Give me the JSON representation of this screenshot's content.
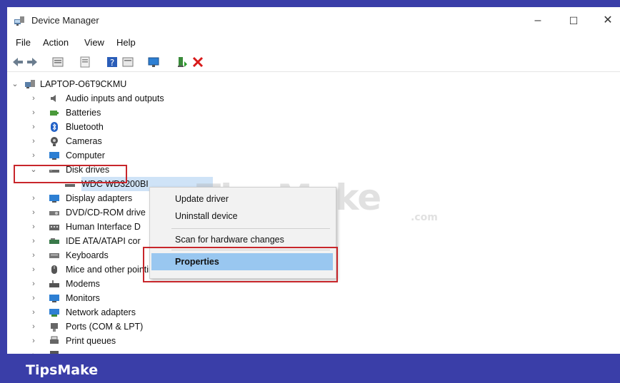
{
  "window": {
    "title": "Device Manager",
    "controls": {
      "minimize": "–",
      "maximize": "☐",
      "close": "✕"
    }
  },
  "menu": [
    "File",
    "Action",
    "View",
    "Help"
  ],
  "tree": {
    "root": "LAPTOP-O6T9CKMU",
    "categories": [
      "Audio inputs and outputs",
      "Batteries",
      "Bluetooth",
      "Cameras",
      "Computer",
      "Disk drives",
      "Display adapters",
      "DVD/CD-ROM drive",
      "Human Interface D",
      "IDE ATA/ATAPI cor",
      "Keyboards",
      "Mice and other pointing devices",
      "Modems",
      "Monitors",
      "Network adapters",
      "Ports (COM & LPT)",
      "Print queues"
    ],
    "disk_child": "WDC WD3200BI"
  },
  "context_menu": {
    "update": "Update driver",
    "uninstall": "Uninstall device",
    "scan": "Scan for hardware changes",
    "properties": "Properties"
  },
  "colors": {
    "highlight_box": "#c8262b",
    "selected_bg": "#99c7f0",
    "brand_bar": "#3a3ea8"
  },
  "watermark": {
    "main": "TipsMake",
    "suffix": ".com"
  },
  "brand": "TipsMake"
}
